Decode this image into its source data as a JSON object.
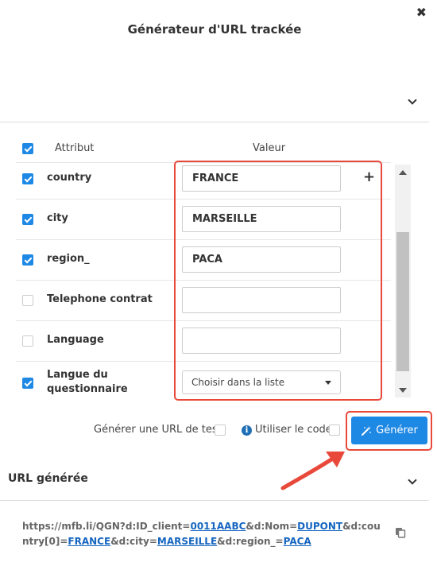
{
  "dialog": {
    "title": "Générateur d'URL trackée",
    "close_glyph": "✖"
  },
  "table": {
    "header": {
      "attribute": "Attribut",
      "value": "Valeur",
      "all_checked": true
    },
    "rows": [
      {
        "label": "country",
        "checked": true,
        "value": "FRANCE",
        "type": "text"
      },
      {
        "label": "city",
        "checked": true,
        "value": "MARSEILLE",
        "type": "text"
      },
      {
        "label": "region_",
        "checked": true,
        "value": "PACA",
        "type": "text"
      },
      {
        "label": "Telephone contrat",
        "checked": false,
        "value": "",
        "type": "text"
      },
      {
        "label": "Language",
        "checked": false,
        "value": "",
        "type": "text"
      },
      {
        "label": "Langue du questionnaire",
        "checked": true,
        "value": "Choisir dans la liste",
        "type": "select"
      }
    ],
    "add_glyph": "+"
  },
  "options": {
    "test_url_label": "Générer une URL de test",
    "test_url_checked": false,
    "use_code_label": "Utiliser le code",
    "use_code_checked": false,
    "info_glyph": "i"
  },
  "generate_button": {
    "label": "Générer",
    "icon": "magic-wand-icon"
  },
  "generated": {
    "section_title": "URL générée",
    "url_parts": [
      {
        "text": "https://mfb.li/QGN?d:ID_client=",
        "link": false
      },
      {
        "text": "0011AABC",
        "link": true
      },
      {
        "text": "&d:Nom=",
        "link": false
      },
      {
        "text": "DUPONT",
        "link": true
      },
      {
        "text": "&d:country[0]=",
        "link": false
      },
      {
        "text": "FRANCE",
        "link": true
      },
      {
        "text": "&d:city=",
        "link": false
      },
      {
        "text": "MARSEILLE",
        "link": true
      },
      {
        "text": "&d:region_=",
        "link": false
      },
      {
        "text": "PACA",
        "link": true
      }
    ],
    "copy_icon": "copy-icon"
  },
  "colors": {
    "accent": "#1e88e5",
    "highlight": "#e8493a",
    "link": "#1565c0"
  }
}
